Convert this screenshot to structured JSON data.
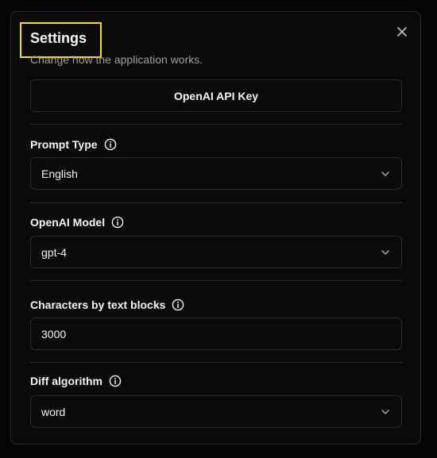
{
  "dialog": {
    "title": "Settings",
    "subtitle": "Change how the application works.",
    "api_key_button_label": "OpenAI API Key"
  },
  "fields": {
    "prompt_type": {
      "label": "Prompt Type",
      "value": "English"
    },
    "openai_model": {
      "label": "OpenAI Model",
      "value": "gpt-4"
    },
    "characters_by_text_blocks": {
      "label": "Characters by text blocks",
      "value": "3000"
    },
    "diff_algorithm": {
      "label": "Diff algorithm",
      "value": "word"
    }
  },
  "icons": {
    "close": "close-icon",
    "info": "info-icon",
    "chevron": "chevron-down-icon"
  },
  "colors": {
    "background": "#0b0a09",
    "border": "#2b2a28",
    "text": "#f5f5f4",
    "muted_text": "#a19e9a",
    "highlight": "#f0e21c"
  }
}
